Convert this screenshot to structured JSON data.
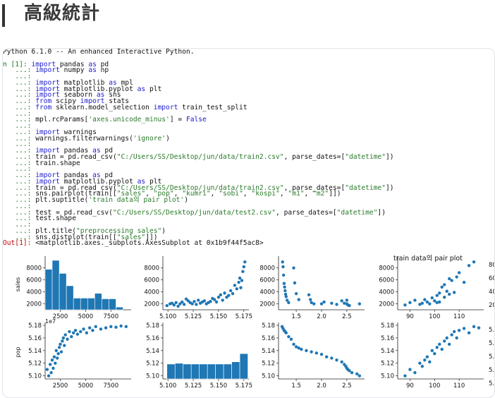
{
  "header": {
    "title": "高級統計"
  },
  "console": {
    "banner": "Python 6.1.0 -- An enhanced Interactive Python.",
    "in_prompt": "n [1]: ",
    "cont_prompt": "   ...: ",
    "out_prompt": "Out[1]: ",
    "lines": [
      [
        [
          "kw",
          "import"
        ],
        [
          "t",
          " pandas "
        ],
        [
          "kw",
          "as"
        ],
        [
          "t",
          " pd"
        ]
      ],
      [
        [
          "kw",
          "import"
        ],
        [
          "t",
          " numpy "
        ],
        [
          "kw",
          "as"
        ],
        [
          "t",
          " np"
        ]
      ],
      [],
      [
        [
          "kw",
          "import"
        ],
        [
          "t",
          " matplotlib "
        ],
        [
          "kw",
          "as"
        ],
        [
          "t",
          " mpl"
        ]
      ],
      [
        [
          "kw",
          "import"
        ],
        [
          "t",
          " matplotlib.pyplot "
        ],
        [
          "kw",
          "as"
        ],
        [
          "t",
          " plt"
        ]
      ],
      [
        [
          "kw",
          "import"
        ],
        [
          "t",
          " seaborn "
        ],
        [
          "kw",
          "as"
        ],
        [
          "t",
          " sns"
        ]
      ],
      [
        [
          "kw",
          "from"
        ],
        [
          "t",
          " scipy "
        ],
        [
          "kw",
          "import"
        ],
        [
          "t",
          " stats"
        ]
      ],
      [
        [
          "kw",
          "from"
        ],
        [
          "t",
          " sklearn.model_selection "
        ],
        [
          "kw",
          "import"
        ],
        [
          "t",
          " train_test_split"
        ]
      ],
      [],
      [
        [
          "t",
          "mpl.rcParams["
        ],
        [
          "str",
          "'axes.unicode_minus'"
        ],
        [
          "t",
          "] = "
        ],
        [
          "kw",
          "False"
        ]
      ],
      [],
      [
        [
          "kw",
          "import"
        ],
        [
          "t",
          " warnings"
        ]
      ],
      [
        [
          "t",
          "warnings.filterwarnings("
        ],
        [
          "str",
          "'ignore'"
        ],
        [
          "t",
          ")"
        ]
      ],
      [],
      [
        [
          "kw",
          "import"
        ],
        [
          "t",
          " pandas "
        ],
        [
          "kw",
          "as"
        ],
        [
          "t",
          " pd"
        ]
      ],
      [
        [
          "t",
          "train = pd.read_csv("
        ],
        [
          "str",
          "\"C:/Users/SS/Desktop/jun/data/train2.csv\""
        ],
        [
          "t",
          ", parse_dates=["
        ],
        [
          "str",
          "\"datetime\""
        ],
        [
          "t",
          "])"
        ]
      ],
      [
        [
          "t",
          "train.shape"
        ]
      ],
      [],
      [
        [
          "kw",
          "import"
        ],
        [
          "t",
          " pandas "
        ],
        [
          "kw",
          "as"
        ],
        [
          "t",
          " pd"
        ]
      ],
      [
        [
          "kw",
          "import"
        ],
        [
          "t",
          " matplotlib.pyplot "
        ],
        [
          "kw",
          "as"
        ],
        [
          "t",
          " plt"
        ]
      ],
      [
        [
          "t",
          "train = pd.read_csv("
        ],
        [
          "str",
          "\"C:/Users/SS/Desktop/jun/data/train2.csv\""
        ],
        [
          "t",
          ", parse_dates=["
        ],
        [
          "str",
          "\"datetime\""
        ],
        [
          "t",
          "])"
        ]
      ],
      [
        [
          "t",
          "sns.pairplot(train[["
        ],
        [
          "str",
          "\"sales\""
        ],
        [
          "t",
          ", "
        ],
        [
          "str",
          "\"pop\""
        ],
        [
          "t",
          ", "
        ],
        [
          "str",
          "\"kumri\""
        ],
        [
          "t",
          ", "
        ],
        [
          "str",
          "\"sobi\""
        ],
        [
          "t",
          ", "
        ],
        [
          "str",
          "\"kospi\""
        ],
        [
          "t",
          ", "
        ],
        [
          "str",
          "\"m1\""
        ],
        [
          "t",
          ", "
        ],
        [
          "str",
          "\"m2\""
        ],
        [
          "t",
          "]])"
        ]
      ],
      [
        [
          "t",
          "plt.suptitle("
        ],
        [
          "str",
          "'train data의 pair plot'"
        ],
        [
          "t",
          ")"
        ]
      ],
      [],
      [
        [
          "t",
          "test = pd.read_csv("
        ],
        [
          "str",
          "\"C:/Users/SS/Desktop/jun/data/test2.csv\""
        ],
        [
          "t",
          ", parse_dates=["
        ],
        [
          "str",
          "\"datetime\""
        ],
        [
          "t",
          "])"
        ]
      ],
      [
        [
          "t",
          "test.shape"
        ]
      ],
      [],
      [
        [
          "t",
          "plt.title("
        ],
        [
          "str",
          "\"preprocessing sales\""
        ],
        [
          "t",
          ")"
        ]
      ],
      [
        [
          "t",
          "sns.distplot(train[["
        ],
        [
          "str",
          "\"sales\""
        ],
        [
          "t",
          "]])"
        ]
      ]
    ],
    "output": "<matplotlib.axes._subplots.AxesSubplot at 0x1b9f44f5ac8>"
  },
  "figure": {
    "suptitle": "train data의 pair plot",
    "ylabel_sales": "sales",
    "ylabel_pop": "pop",
    "offset_text": "1e7",
    "ticks": {
      "sales_y": [
        "8000",
        "6000",
        "4000",
        "2000"
      ],
      "pop_y": [
        "5.18",
        "5.16",
        "5.14",
        "5.12",
        "5.10"
      ],
      "sales_x": [
        "2500",
        "5000",
        "7500"
      ],
      "pop_x": [
        "5.100",
        "5.125",
        "5.150",
        "5.175"
      ],
      "kumri_x": [
        "1.5",
        "2.0",
        "2.5"
      ],
      "sobi_x": [
        "90",
        "100",
        "110"
      ],
      "edge_right_top": [
        "80",
        "60",
        "40",
        "20"
      ],
      "edge_right_bottom": [
        "5.",
        "5.",
        "5.",
        "5.",
        "5."
      ]
    }
  },
  "chart_data": [
    {
      "type": "bar",
      "panel": "sales vs sales",
      "categories": [
        "1000-1700",
        "1700-2400",
        "2400-3100",
        "3100-3800",
        "3800-4500",
        "4500-5200",
        "5200-5900",
        "5900-6600",
        "6600-7300",
        "7300-8000",
        "8000-8700",
        "8700-9400"
      ],
      "values": [
        5.9,
        7.2,
        5.3,
        3.5,
        1.7,
        1.7,
        1.7,
        2.4,
        1.6,
        1.6,
        0.4,
        0
      ],
      "xlabel": "",
      "ylabel": "sales"
    },
    {
      "type": "scatter",
      "panel": "sales vs pop",
      "x": [
        5.099,
        5.102,
        5.104,
        5.106,
        5.108,
        5.11,
        5.112,
        5.114,
        5.116,
        5.118,
        5.12,
        5.122,
        5.124,
        5.126,
        5.128,
        5.13,
        5.132,
        5.134,
        5.136,
        5.138,
        5.14,
        5.142,
        5.144,
        5.146,
        5.148,
        5.15,
        5.152,
        5.154,
        5.156,
        5.158,
        5.16,
        5.162,
        5.164,
        5.166,
        5.168,
        5.17,
        5.171,
        5.172,
        5.173,
        5.174,
        5.175,
        5.176
      ],
      "y": [
        1700,
        2000,
        2100,
        1800,
        2200,
        1600,
        2000,
        2300,
        1900,
        2800,
        2500,
        2200,
        2000,
        2400,
        1900,
        2600,
        2100,
        2300,
        2500,
        2000,
        2200,
        2400,
        2900,
        2700,
        2300,
        3100,
        3500,
        2600,
        3800,
        3100,
        3400,
        4200,
        3700,
        5100,
        4500,
        5600,
        6300,
        4700,
        5900,
        7400,
        8200,
        9000
      ],
      "xlabel": "",
      "ylabel": ""
    },
    {
      "type": "scatter",
      "panel": "sales vs kumri",
      "x": [
        1.23,
        1.24,
        1.25,
        1.26,
        1.27,
        1.28,
        1.29,
        1.3,
        1.32,
        1.35,
        1.45,
        1.47,
        1.5,
        1.55,
        1.75,
        1.78,
        1.8,
        1.85,
        2.0,
        2.05,
        2.2,
        2.3,
        2.4,
        2.45,
        2.5,
        2.5,
        2.52,
        2.55,
        2.75
      ],
      "y": [
        9000,
        8200,
        6800,
        5400,
        4800,
        4200,
        3600,
        3200,
        2600,
        2200,
        8000,
        5500,
        3700,
        2700,
        3500,
        2700,
        2200,
        2000,
        2000,
        2300,
        2100,
        1900,
        2500,
        2100,
        2000,
        2600,
        1800,
        1700,
        2000
      ],
      "xlabel": "",
      "ylabel": ""
    },
    {
      "type": "scatter",
      "panel": "sales vs sobi",
      "x": [
        88,
        90,
        92,
        94,
        95,
        96,
        97,
        98,
        99,
        100,
        101,
        101,
        102,
        102,
        103,
        104,
        104,
        105,
        106,
        106,
        107,
        108,
        109,
        110,
        112,
        114,
        116
      ],
      "y": [
        1800,
        2200,
        2600,
        1900,
        2100,
        2700,
        2300,
        2000,
        3000,
        2500,
        2200,
        3400,
        3800,
        2300,
        4800,
        3100,
        5200,
        4100,
        3600,
        6200,
        5900,
        3900,
        6500,
        7200,
        5600,
        8400,
        9000
      ],
      "xlabel": "",
      "ylabel": ""
    },
    {
      "type": "scatter",
      "panel": "pop vs sales",
      "x": [
        1200,
        1350,
        1500,
        1600,
        1700,
        1800,
        1900,
        2000,
        2100,
        2200,
        2300,
        2400,
        2500,
        2600,
        2700,
        2800,
        2900,
        3000,
        3200,
        3400,
        3600,
        3800,
        4000,
        4200,
        4500,
        4800,
        5100,
        5400,
        5700,
        6000,
        6500,
        7000,
        7500,
        8000,
        8500,
        9000
      ],
      "y": [
        5.11,
        5.1,
        5.118,
        5.105,
        5.125,
        5.112,
        5.13,
        5.12,
        5.14,
        5.128,
        5.135,
        5.145,
        5.15,
        5.138,
        5.155,
        5.16,
        5.148,
        5.165,
        5.158,
        5.17,
        5.162,
        5.168,
        5.172,
        5.166,
        5.17,
        5.174,
        5.168,
        5.176,
        5.172,
        5.178,
        5.174,
        5.176,
        5.178,
        5.177,
        5.179,
        5.178
      ],
      "xlabel": "",
      "ylabel": "pop"
    },
    {
      "type": "bar",
      "panel": "pop vs pop",
      "categories": [
        "5.099-5.107",
        "5.107-5.115",
        "5.115-5.123",
        "5.123-5.131",
        "5.131-5.139",
        "5.139-5.147",
        "5.147-5.155",
        "5.155-5.163",
        "5.163-5.171",
        "5.171-5.179"
      ],
      "values": [
        2,
        2.1,
        2,
        2,
        2,
        2,
        2,
        2,
        2.3,
        3.4
      ],
      "xlabel": "",
      "ylabel": ""
    },
    {
      "type": "scatter",
      "panel": "pop vs kumri",
      "x": [
        1.22,
        1.24,
        1.26,
        1.28,
        1.3,
        1.35,
        1.4,
        1.45,
        1.5,
        1.55,
        1.6,
        1.7,
        1.8,
        1.9,
        2.0,
        2.1,
        2.2,
        2.3,
        2.4,
        2.45,
        2.48,
        2.5,
        2.52,
        2.55,
        2.6,
        2.7,
        2.75
      ],
      "y": [
        5.178,
        5.175,
        5.172,
        5.17,
        5.168,
        5.162,
        5.158,
        5.15,
        5.146,
        5.144,
        5.142,
        5.14,
        5.138,
        5.136,
        5.134,
        5.13,
        5.128,
        5.125,
        5.122,
        5.118,
        5.115,
        5.112,
        5.11,
        5.108,
        5.105,
        5.103,
        5.1
      ],
      "xlabel": "",
      "ylabel": ""
    },
    {
      "type": "scatter",
      "panel": "pop vs sobi",
      "x": [
        88,
        90,
        92,
        94,
        95,
        96,
        97,
        98,
        99,
        100,
        101,
        102,
        103,
        104,
        105,
        106,
        107,
        108,
        109,
        110,
        112,
        114,
        116,
        118
      ],
      "y": [
        5.1,
        5.11,
        5.105,
        5.12,
        5.115,
        5.125,
        5.13,
        5.122,
        5.14,
        5.135,
        5.145,
        5.15,
        5.142,
        5.155,
        5.16,
        5.15,
        5.165,
        5.17,
        5.16,
        5.172,
        5.175,
        5.168,
        5.178,
        5.176
      ],
      "xlabel": "",
      "ylabel": ""
    }
  ],
  "colors": {
    "marker": "#1f77b4",
    "prompt_green": "#1a7a1a",
    "prompt_red": "#c00000",
    "keyword": "#1a1ad0",
    "string": "#2a7a2a"
  }
}
